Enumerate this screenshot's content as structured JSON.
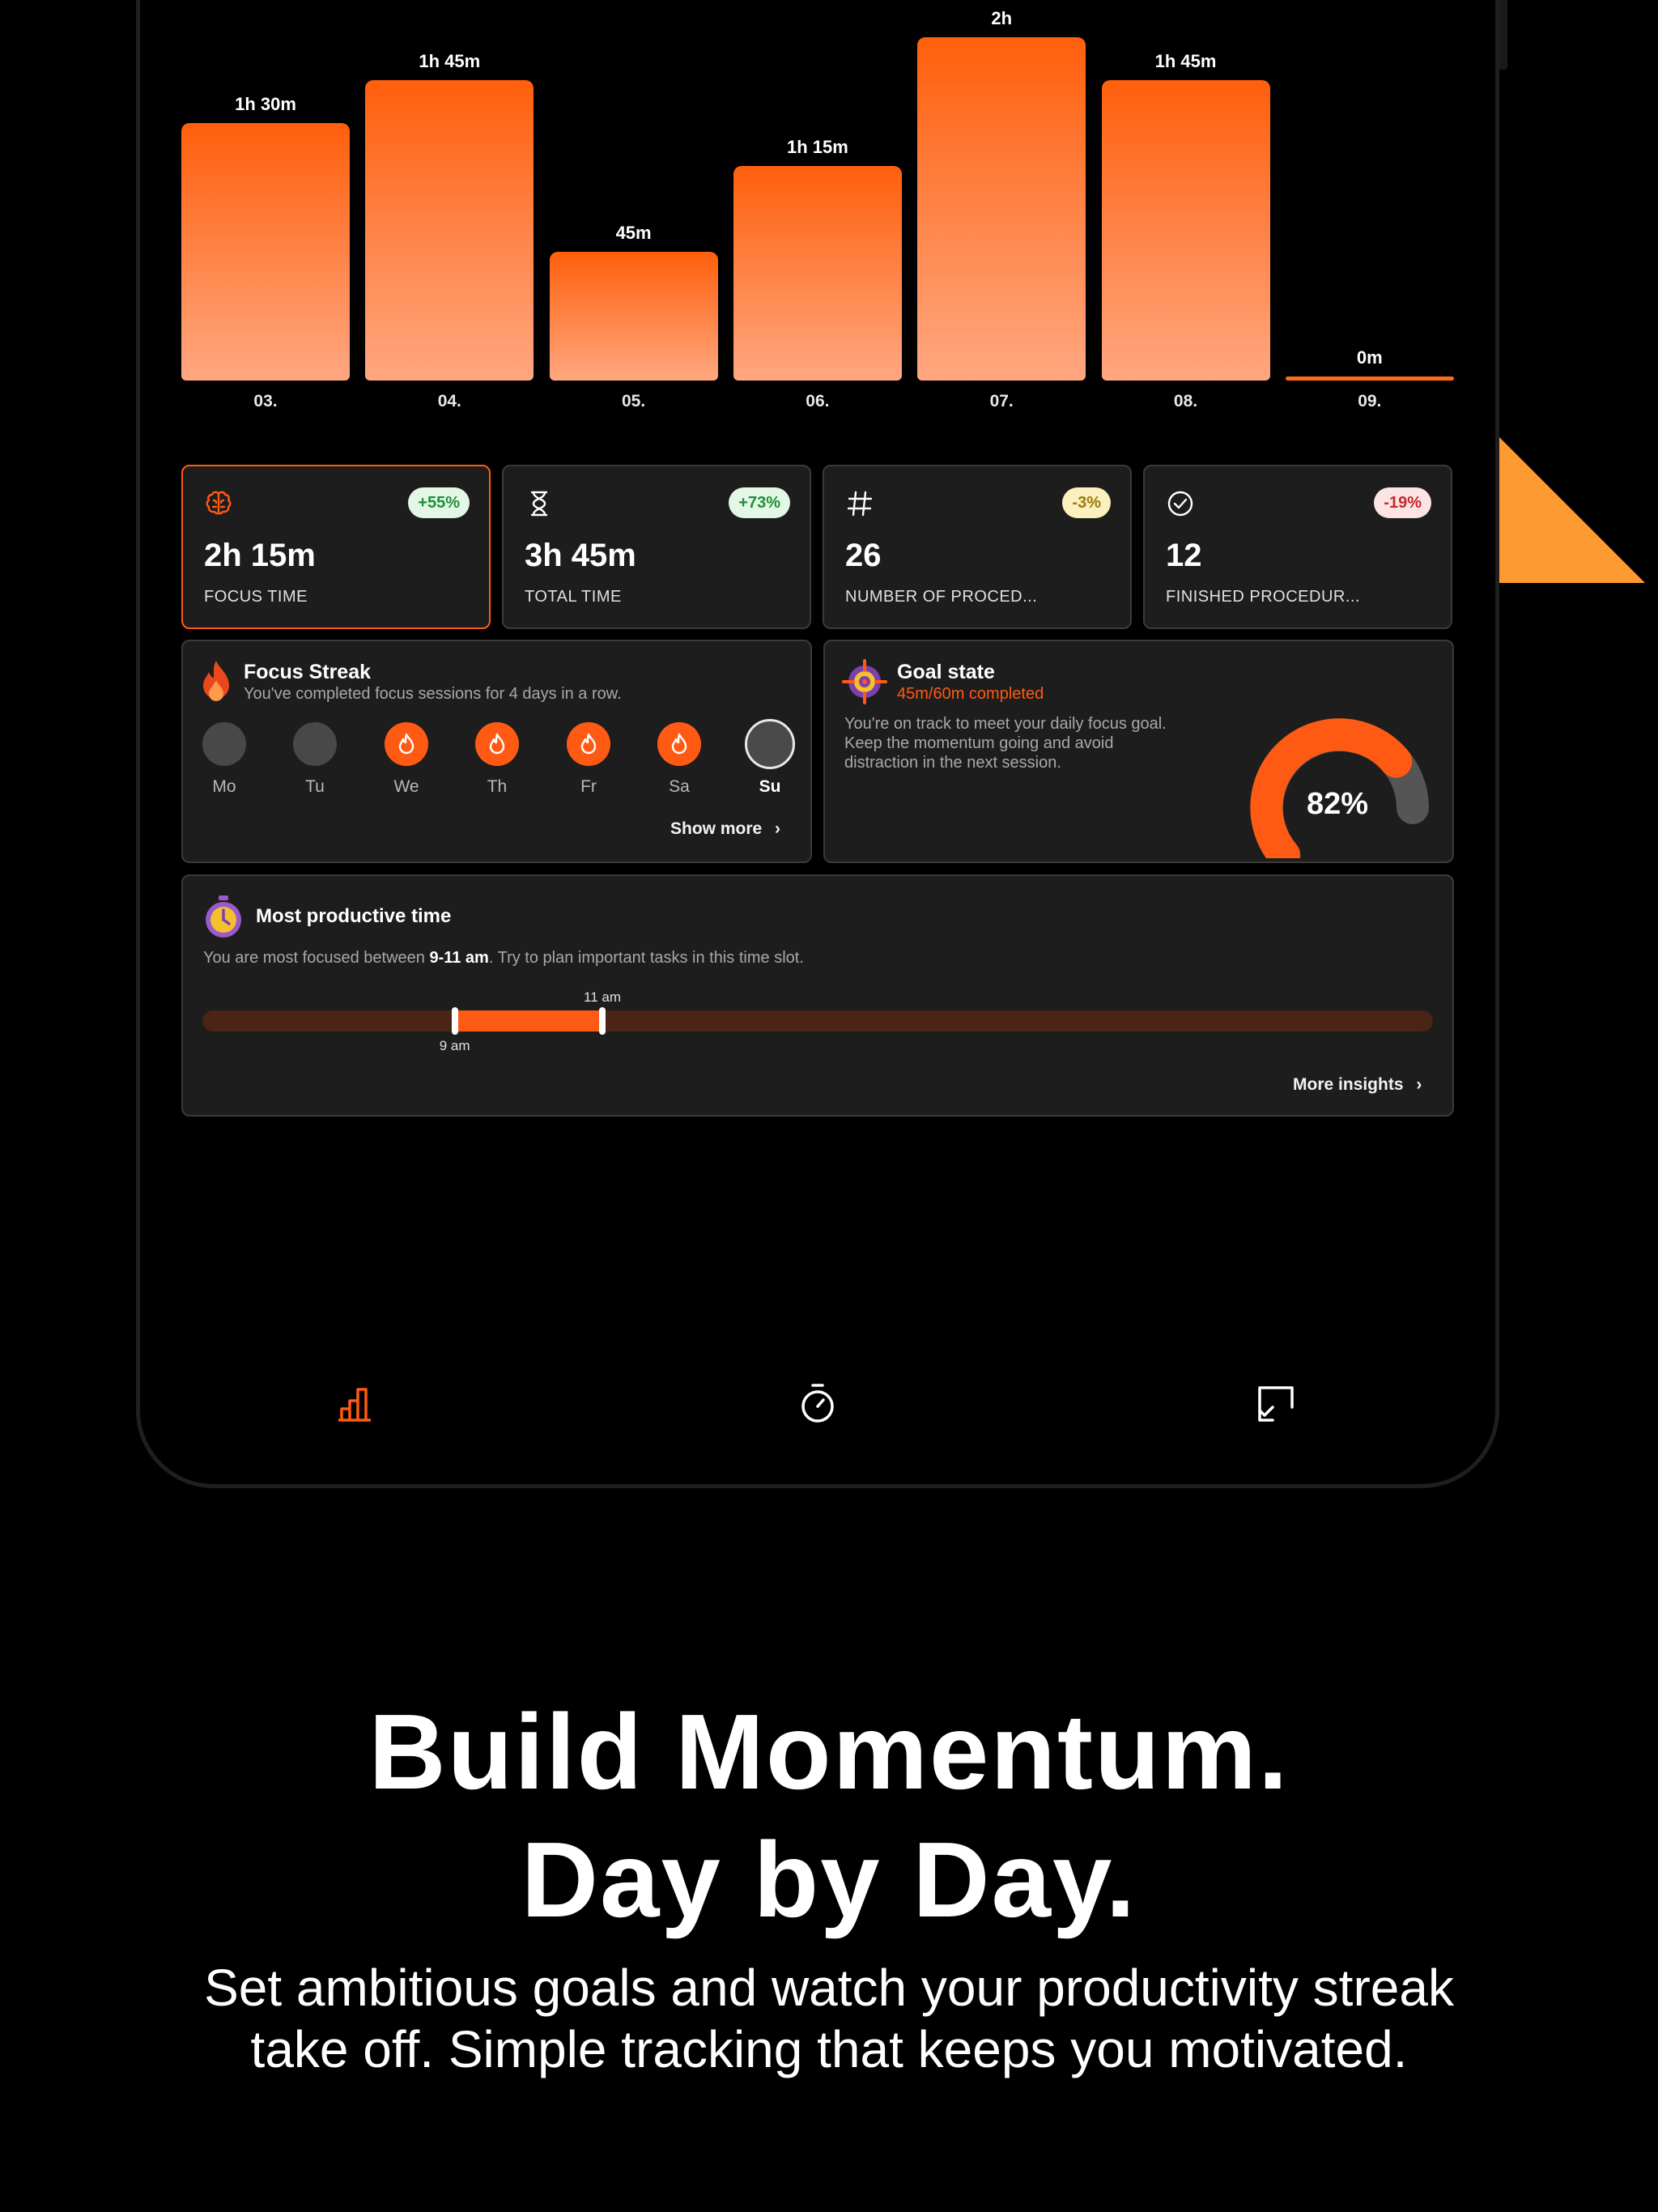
{
  "chart_data": {
    "type": "bar",
    "categories": [
      "03.",
      "04.",
      "05.",
      "06.",
      "07.",
      "08.",
      "09."
    ],
    "values": [
      90,
      105,
      45,
      75,
      120,
      105,
      0
    ],
    "value_labels": [
      "1h 30m",
      "1h 45m",
      "45m",
      "1h 15m",
      "2h",
      "1h 45m",
      "0m"
    ],
    "ylim": [
      0,
      120
    ],
    "colors": {
      "bar_top": "#ff5f0c",
      "bar_bottom": "#ffa780"
    }
  },
  "stats": [
    {
      "icon": "brain-icon",
      "badge": "+55%",
      "badge_type": "pos",
      "value": "2h 15m",
      "label": "FOCUS TIME",
      "active": true
    },
    {
      "icon": "hourglass-icon",
      "badge": "+73%",
      "badge_type": "pos",
      "value": "3h 45m",
      "label": "TOTAL TIME",
      "active": false
    },
    {
      "icon": "hash-icon",
      "badge": "-3%",
      "badge_type": "warn",
      "value": "26",
      "label": "NUMBER OF PROCED...",
      "active": false
    },
    {
      "icon": "check-circle-icon",
      "badge": "-19%",
      "badge_type": "neg",
      "value": "12",
      "label": "FINISHED PROCEDUR...",
      "active": false
    }
  ],
  "streak": {
    "title": "Focus Streak",
    "subtitle": "You've completed focus sessions for 4 days in a row.",
    "days": [
      {
        "label": "Mo",
        "state": "off"
      },
      {
        "label": "Tu",
        "state": "off"
      },
      {
        "label": "We",
        "state": "on"
      },
      {
        "label": "Th",
        "state": "on"
      },
      {
        "label": "Fr",
        "state": "on"
      },
      {
        "label": "Sa",
        "state": "on"
      },
      {
        "label": "Su",
        "state": "today"
      }
    ],
    "link": "Show more"
  },
  "goal": {
    "title": "Goal state",
    "progress_text": "45m/60m completed",
    "description_lines": [
      "You're on track to meet your daily focus goal.",
      "Keep the momentum going and avoid",
      "distraction in the next session."
    ],
    "percent_label": "82%",
    "percent": 0.82
  },
  "productive": {
    "title": "Most productive time",
    "text_before": "You are most focused between ",
    "text_bold": "9-11 am",
    "text_after": ". Try to plan important tasks in this time slot.",
    "start_label": "9 am",
    "end_label": "11 am",
    "start_fraction": 0.205,
    "end_fraction": 0.325,
    "link": "More insights"
  },
  "nav": {
    "items": [
      {
        "icon": "bar-chart-icon",
        "active": true
      },
      {
        "icon": "stopwatch-icon",
        "active": false
      },
      {
        "icon": "checklist-icon",
        "active": false
      }
    ]
  },
  "marketing": {
    "headline_1": "Build Momentum.",
    "headline_2": "Day by Day.",
    "subtext_1": "Set ambitious goals and watch your productivity streak",
    "subtext_2": "take off. Simple tracking that keeps you motivated."
  },
  "colors": {
    "accent": "#ff5a14",
    "stripe": "#ff9a30",
    "card_bg": "#1d1d1d"
  }
}
